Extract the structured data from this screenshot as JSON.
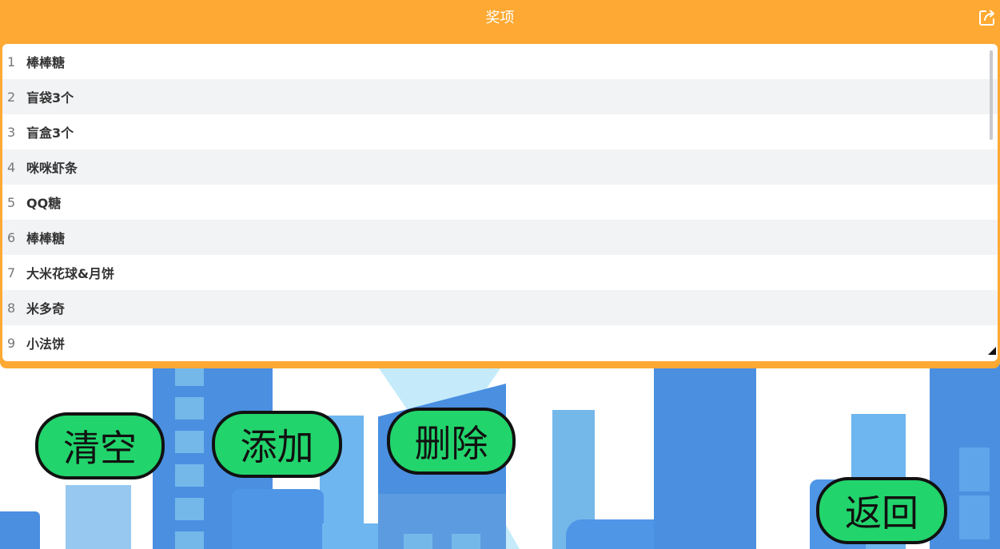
{
  "header": {
    "title": "奖项",
    "export_icon": "share-export-icon"
  },
  "prizes": [
    {
      "num": "1",
      "name": "棒棒糖"
    },
    {
      "num": "2",
      "name": "盲袋3个"
    },
    {
      "num": "3",
      "name": "盲盒3个"
    },
    {
      "num": "4",
      "name": "咪咪虾条"
    },
    {
      "num": "5",
      "name": "QQ糖"
    },
    {
      "num": "6",
      "name": "棒棒糖"
    },
    {
      "num": "7",
      "name": "大米花球&月饼"
    },
    {
      "num": "8",
      "name": "米多奇"
    },
    {
      "num": "9",
      "name": "小法饼"
    }
  ],
  "buttons": {
    "clear": "清空",
    "add": "添加",
    "delete": "删除",
    "back": "返回"
  },
  "colors": {
    "panel": "#fea933",
    "button_fill": "#22d46c",
    "button_border": "#111111",
    "row_alt": "#f2f3f5",
    "building_blue": "#4a8fe0",
    "building_light": "#74b8ea",
    "sky_light": "#c5ebfb"
  }
}
